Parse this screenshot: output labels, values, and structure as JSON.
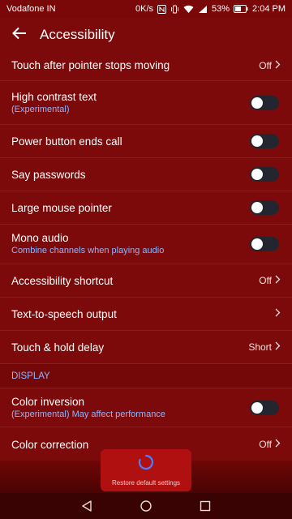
{
  "status_bar": {
    "carrier": "Vodafone IN",
    "speed": "0K/s",
    "battery": "53%",
    "time": "2:04 PM"
  },
  "app_bar": {
    "title": "Accessibility"
  },
  "settings": {
    "touch_after_pointer": {
      "title": "Touch after pointer stops moving",
      "value": "Off"
    },
    "high_contrast_text": {
      "title": "High contrast text",
      "subtitle": "(Experimental)",
      "enabled": false
    },
    "power_button_ends_call": {
      "title": "Power button ends call",
      "enabled": false
    },
    "say_passwords": {
      "title": "Say passwords",
      "enabled": false
    },
    "large_mouse_pointer": {
      "title": "Large mouse pointer",
      "enabled": false
    },
    "mono_audio": {
      "title": "Mono audio",
      "subtitle": "Combine channels when playing audio",
      "enabled": false
    },
    "accessibility_shortcut": {
      "title": "Accessibility shortcut",
      "value": "Off"
    },
    "text_to_speech": {
      "title": "Text-to-speech output"
    },
    "touch_hold_delay": {
      "title": "Touch & hold delay",
      "value": "Short"
    }
  },
  "display_section": {
    "header": "DISPLAY",
    "color_inversion": {
      "title": "Color inversion",
      "subtitle": "(Experimental) May affect performance",
      "enabled": false
    },
    "color_correction": {
      "title": "Color correction",
      "value": "Off"
    }
  },
  "restore_button": {
    "label": "Restore default settings"
  },
  "icons": [
    "back-arrow-icon",
    "chevron-right-icon",
    "loading-spinner-icon",
    "nav-back-icon",
    "nav-home-icon",
    "nav-recents-icon",
    "wifi-icon",
    "signal-icon",
    "battery-icon",
    "nfc-icon",
    "vibrate-icon"
  ],
  "colors": {
    "background": "#7d0a0a",
    "accent": "#8fb5ff",
    "toggle_off": "#23262e",
    "restore_button": "#b01010"
  }
}
